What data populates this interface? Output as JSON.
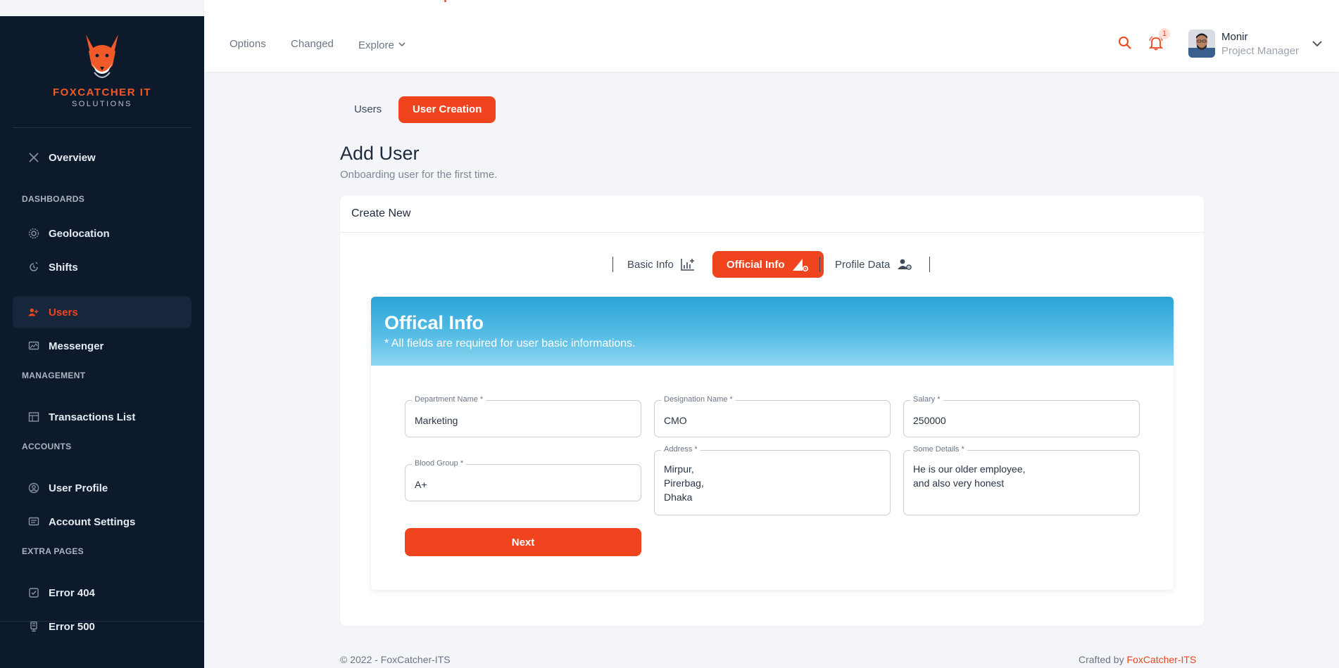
{
  "brand": {
    "name": "FOXCATCHER IT",
    "sub": "SOLUTIONS"
  },
  "sidebar": {
    "overview": "Overview",
    "sections": {
      "dashboards": "DASHBOARDS",
      "management": "MANAGEMENT",
      "accounts": "ACCOUNTS",
      "extra": "EXTRA PAGES"
    },
    "items": {
      "geolocation": "Geolocation",
      "shifts": "Shifts",
      "users": "Users",
      "messenger": "Messenger",
      "transactions": "Transactions List",
      "user_profile": "User Profile",
      "account_settings": "Account Settings",
      "error404": "Error 404",
      "error500": "Error 500"
    },
    "active": "users"
  },
  "header": {
    "links": {
      "options": "Options",
      "changed": "Changed",
      "explore": "Explore"
    },
    "notification_count": "1",
    "user": {
      "name": "Monir",
      "role": "Project Manager"
    }
  },
  "page_tabs": {
    "users": "Users",
    "user_creation": "User Creation"
  },
  "page": {
    "title": "Add User",
    "subtitle": "Onboarding user for the first time."
  },
  "card": {
    "header": "Create New"
  },
  "steps": {
    "basic": "Basic Info",
    "official": "Official Info",
    "profile": "Profile Data"
  },
  "banner": {
    "title": "Offical Info",
    "subtitle": "* All fields are required for user basic informations."
  },
  "form": {
    "department": {
      "label": "Department Name *",
      "value": "Marketing"
    },
    "designation": {
      "label": "Designation Name *",
      "value": "CMO"
    },
    "salary": {
      "label": "Salary *",
      "value": "250000"
    },
    "blood_group": {
      "label": "Blood Group *",
      "value": "A+"
    },
    "address": {
      "label": "Address *",
      "value": "Mirpur,\nPirerbag,\nDhaka"
    },
    "details": {
      "label": "Some Details *",
      "value": "He is our older employee,\nand also very honest"
    },
    "next_label": "Next"
  },
  "footer": {
    "copyright": "© 2022 - FoxCatcher-ITS",
    "crafted_prefix": "Crafted by ",
    "crafted_by": "FoxCatcher-ITS"
  },
  "colors": {
    "accent": "#f0441e",
    "sidebar_bg": "#0c1a2c",
    "banner": "#3fb1dd"
  },
  "icons": [
    "fox-logo",
    "overview-icon",
    "geolocation-icon",
    "shifts-icon",
    "users-icon",
    "messenger-icon",
    "transactions-icon",
    "user-profile-icon",
    "account-settings-icon",
    "error-404-icon",
    "error-500-icon",
    "search-icon",
    "bell-icon",
    "chevron-down-icon",
    "chart-add-icon",
    "pen-gear-icon",
    "user-gear-icon"
  ]
}
